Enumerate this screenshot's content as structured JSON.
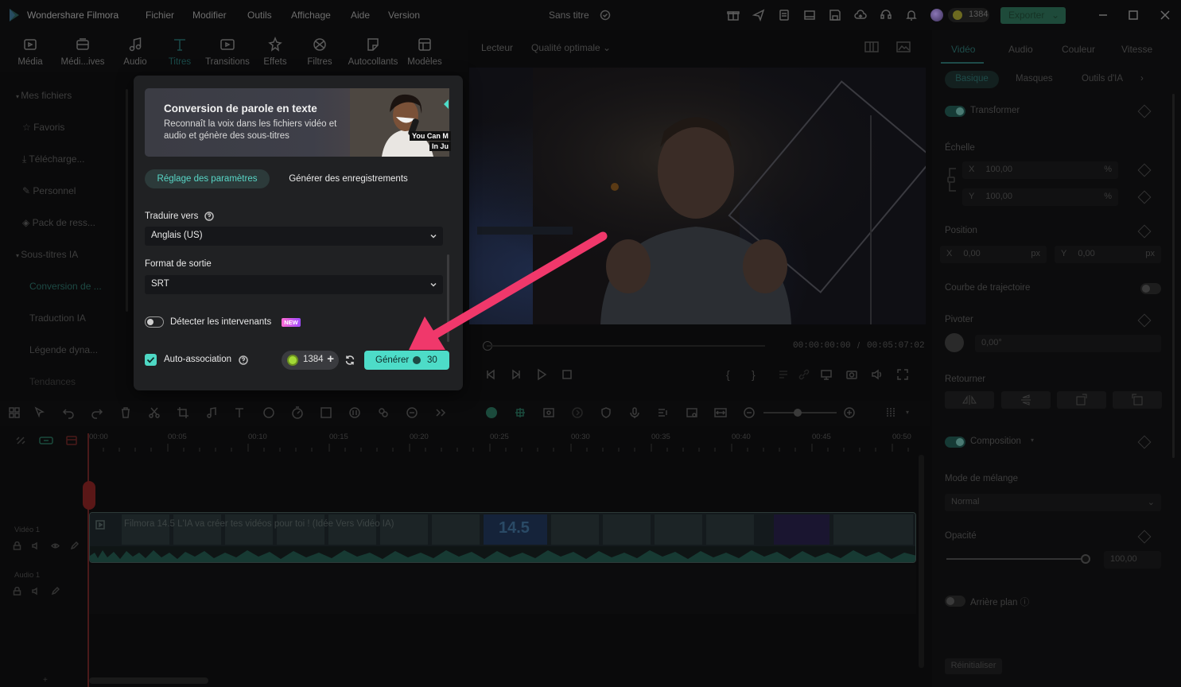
{
  "titlebar": {
    "app_name": "Wondershare Filmora",
    "menus": [
      "Fichier",
      "Modifier",
      "Outils",
      "Affichage",
      "Aide",
      "Version"
    ],
    "doc_title": "Sans titre",
    "credits": "1384",
    "export_label": "Exporter"
  },
  "tool_tabs": [
    {
      "label": "Média",
      "icon": "media-icon"
    },
    {
      "label": "Médi...ives",
      "icon": "stock-media-icon"
    },
    {
      "label": "Audio",
      "icon": "music-icon"
    },
    {
      "label": "Titres",
      "icon": "titles-icon"
    },
    {
      "label": "Transitions",
      "icon": "transitions-icon"
    },
    {
      "label": "Effets",
      "icon": "effects-icon"
    },
    {
      "label": "Filtres",
      "icon": "filters-icon"
    },
    {
      "label": "Autocollants",
      "icon": "stickers-icon"
    },
    {
      "label": "Modèles",
      "icon": "templates-icon"
    }
  ],
  "sidebar": {
    "items": [
      "Mes fichiers",
      "Favoris",
      "Télécharge...",
      "Personnel",
      "Pack de ress...",
      "Sous-titres IA",
      "Conversion de ...",
      "Traduction IA",
      "Légende dyna...",
      "Tendances"
    ]
  },
  "stt_panel": {
    "title": "Conversion de parole en texte",
    "description": "Reconnaît la voix dans les fichiers vidéo et audio et génère des sous-titres",
    "banner_tag_1": "You Can M",
    "banner_tag_2": "In Ju",
    "tab_params": "Réglage des paramètres",
    "tab_records": "Générer des enregistrements",
    "translate_label": "Traduire vers",
    "translate_value": "Anglais (US)",
    "format_label": "Format de sortie",
    "format_value": "SRT",
    "detect_label": "Détecter les intervenants",
    "detect_badge": "NEW",
    "auto_label": "Auto-association",
    "credits": "1384",
    "generate_label": "Générer",
    "generate_cost": "30"
  },
  "player": {
    "label": "Lecteur",
    "quality": "Qualité optimale",
    "time_current": "00:00:00:00",
    "time_separator": "/",
    "time_total": "00:05:07:02"
  },
  "right_panel": {
    "tabs": [
      "Vidéo",
      "Audio",
      "Couleur",
      "Vitesse"
    ],
    "subtabs": [
      "Basique",
      "Masques",
      "Outils d'IA"
    ],
    "transform_label": "Transformer",
    "scale_label": "Échelle",
    "scale_x_axis": "X",
    "scale_x": "100,00",
    "scale_y_axis": "Y",
    "scale_y": "100,00",
    "pct": "%",
    "position_label": "Position",
    "pos_x_axis": "X",
    "pos_x": "0,00",
    "pos_y_axis": "Y",
    "pos_y": "0,00",
    "px": "px",
    "trajectory_label": "Courbe de trajectoire",
    "rotate_label": "Pivoter",
    "rotate_value": "0,00°",
    "flip_label": "Retourner",
    "composition_label": "Composition",
    "blend_label": "Mode de mélange",
    "blend_value": "Normal",
    "opacity_label": "Opacité",
    "opacity_value": "100,00",
    "opacity_level": 1.0,
    "background_label": "Arrière plan",
    "reset_label": "Réinitialiser"
  },
  "timeline": {
    "ticks": [
      "00:00",
      "00:05",
      "00:10",
      "00:15",
      "00:20",
      "00:25",
      "00:30",
      "00:35",
      "00:40",
      "00:45",
      "00:50"
    ],
    "clip_title": "Filmora 14.5 L'IA va créer tes vidéos pour toi ! (Idée Vers Vidéo IA)",
    "clip_overlay": "14.5",
    "track_video": "Vidéo 1",
    "track_audio": "Audio 1"
  },
  "colors": {
    "accent": "#4ddcc8",
    "annotation_arrow": "#f0386b",
    "panel_bg": "#202123",
    "new_badge": "#ff6bd3"
  }
}
